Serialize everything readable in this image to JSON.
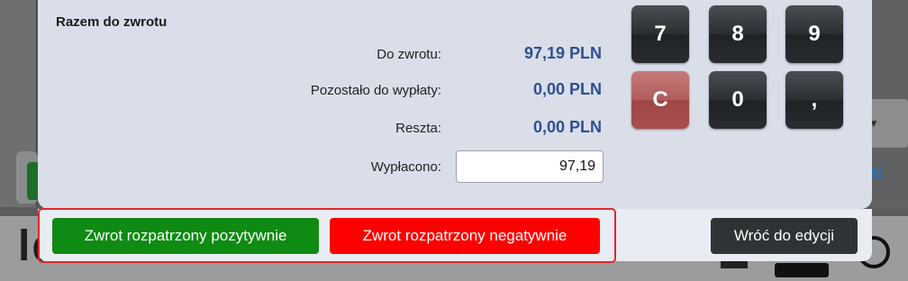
{
  "dialog": {
    "title": "Razem do zwrotu",
    "rows": [
      {
        "label": "Do zwrotu:",
        "value": "97,19 PLN"
      },
      {
        "label": "Pozostało do wypłaty:",
        "value": "0,00 PLN"
      },
      {
        "label": "Reszta:",
        "value": "0,00 PLN"
      }
    ],
    "paid": {
      "label": "Wypłacono:",
      "value": "97,19"
    }
  },
  "keypad": {
    "keys": [
      "7",
      "8",
      "9",
      "C",
      "0",
      ","
    ]
  },
  "footer": {
    "positive_label": "Zwrot rozpatrzony pozytywnie",
    "negative_label": "Zwrot rozpatrzony negatywnie",
    "back_label": "Wróć do edycji"
  },
  "background": {
    "logo_text": "ldeeli POS"
  },
  "colors": {
    "value_blue": "#2f4f8f",
    "positive_green": "#0f8a12",
    "negative_red": "#ff0000",
    "highlight_border": "#e1272d",
    "clear_key": "#b05c5c"
  }
}
